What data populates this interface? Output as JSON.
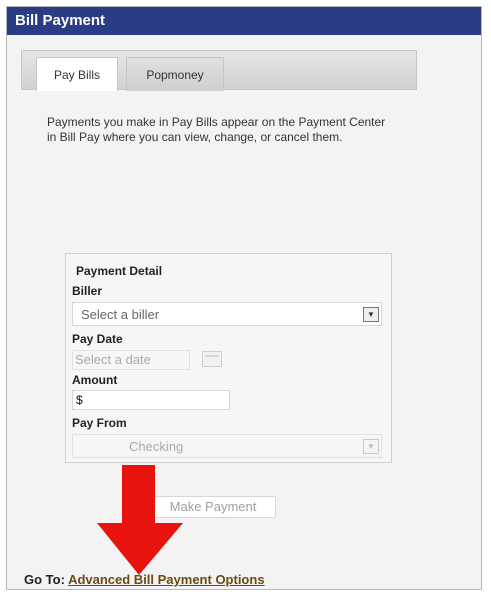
{
  "window": {
    "title": "Bill Payment"
  },
  "tabs": [
    {
      "label": "Pay Bills",
      "active": true
    },
    {
      "label": "Popmoney",
      "active": false
    }
  ],
  "info_text": "Payments you make in Pay Bills appear on the Payment Center in Bill Pay where you can view, change, or cancel them.",
  "payment_detail": {
    "heading": "Payment Detail",
    "biller_label": "Biller",
    "biller_value": "Select a biller",
    "pay_date_label": "Pay Date",
    "pay_date_placeholder": "Select a date",
    "amount_label": "Amount",
    "amount_value": "$",
    "pay_from_label": "Pay From",
    "pay_from_value": "Checking"
  },
  "make_payment_label": "Make Payment",
  "footer": {
    "goto_label": "Go To:",
    "link_text": "Advanced Bill Payment Options"
  },
  "icons": {
    "dropdown": "chevron-down-icon",
    "calendar": "calendar-icon",
    "arrow": "red-arrow-down-icon"
  },
  "colors": {
    "titlebar": "#2a3c86",
    "arrow": "#e8130f",
    "link": "#6b4b12"
  }
}
